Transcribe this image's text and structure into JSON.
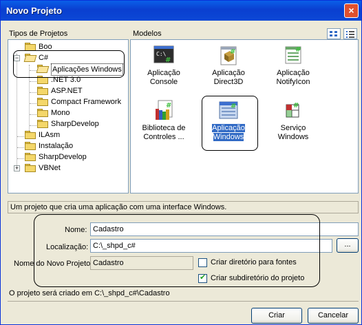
{
  "window": {
    "title": "Novo Projeto",
    "close_glyph": "×"
  },
  "project_types": {
    "label": "Tipos de Projetos",
    "items": [
      {
        "label": "Boo"
      },
      {
        "label": "C#"
      },
      {
        "label": "Aplicações Windows"
      },
      {
        "label": ".NET 3.0"
      },
      {
        "label": "ASP.NET"
      },
      {
        "label": "Compact Framework"
      },
      {
        "label": "Mono"
      },
      {
        "label": "SharpDevelop"
      },
      {
        "label": "ILAsm"
      },
      {
        "label": "Instalação"
      },
      {
        "label": "SharpDevelop"
      },
      {
        "label": "VBNet"
      }
    ]
  },
  "templates": {
    "label": "Modelos",
    "items": [
      {
        "label": "Aplicação Console",
        "icon": "console-app-icon"
      },
      {
        "label": "Aplicação Direct3D",
        "icon": "direct3d-app-icon"
      },
      {
        "label": "Aplicação NotifyIcon",
        "icon": "notifyicon-app-icon"
      },
      {
        "label": "Biblioteca de Controles ...",
        "icon": "control-library-icon"
      },
      {
        "label": "Aplicação Windows",
        "icon": "windows-app-icon"
      },
      {
        "label": "Serviço Windows",
        "icon": "windows-service-icon"
      }
    ]
  },
  "description": "Um projeto que cria uma aplicação com uma interface Windows.",
  "form": {
    "name_label": "Nome:",
    "name_value": "Cadastro",
    "location_label": "Localização:",
    "location_value": "C:\\_shpd_c#",
    "browse_label": "...",
    "new_project_name_label": "Nome do Novo Projeto",
    "new_project_name_value": "Cadastro",
    "create_dir_for_sources_label": "Criar diretório para fontes",
    "create_dir_for_sources_checked": false,
    "create_project_subdir_label": "Criar subdiretório do projeto",
    "create_project_subdir_checked": true
  },
  "status": "O projeto será criado em C:\\_shpd_c#\\Cadastro",
  "buttons": {
    "create": "Criar",
    "cancel": "Cancelar"
  }
}
